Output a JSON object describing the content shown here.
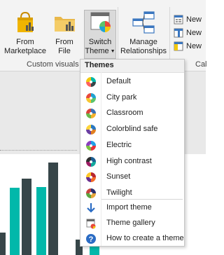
{
  "ribbon": {
    "buttons": [
      {
        "label_line1": "From",
        "label_line2": "Marketplace",
        "icon": "shopping-bag-icon"
      },
      {
        "label_line1": "From",
        "label_line2": "File",
        "icon": "folder-chart-icon"
      },
      {
        "label_line1": "Switch",
        "label_line2": "Theme",
        "icon": "switch-theme-icon"
      },
      {
        "label_line1": "Manage",
        "label_line2": "Relationships",
        "icon": "relationships-icon"
      }
    ],
    "groups": {
      "custom_visuals": "Custom visuals",
      "cal": "Cal"
    },
    "small_buttons": [
      {
        "label": "New",
        "icon": "new-measure-icon"
      },
      {
        "label": "New",
        "icon": "new-column-icon"
      },
      {
        "label": "New",
        "icon": "new-table-icon"
      }
    ]
  },
  "menu": {
    "header": "Themes",
    "themes": [
      {
        "label": "Default",
        "colors": [
          "#01b8aa",
          "#374649",
          "#fd625e",
          "#f2c80f"
        ]
      },
      {
        "label": "City park",
        "colors": [
          "#20a3d3",
          "#5ac46c",
          "#f7c631",
          "#e8493b"
        ]
      },
      {
        "label": "Classroom",
        "colors": [
          "#3a6fb5",
          "#f5b12b",
          "#69b84a",
          "#d9453a"
        ]
      },
      {
        "label": "Colorblind safe",
        "colors": [
          "#2a78c2",
          "#e07f22",
          "#6b3fa0",
          "#ffd43b"
        ]
      },
      {
        "label": "Electric",
        "colors": [
          "#1ea0e8",
          "#e6333a",
          "#7cc242",
          "#8a3fbf"
        ]
      },
      {
        "label": "High contrast",
        "colors": [
          "#1d5f91",
          "#13a89e",
          "#9b1d64",
          "#2f2f2f"
        ]
      },
      {
        "label": "Sunset",
        "colors": [
          "#b8272f",
          "#f46a27",
          "#6a2f8f",
          "#ffc627"
        ]
      },
      {
        "label": "Twilight",
        "colors": [
          "#2b2f6d",
          "#e6a53a",
          "#5aa53f",
          "#c6453e"
        ]
      }
    ],
    "actions": [
      {
        "label": "Import theme",
        "icon": "import-arrow-icon"
      },
      {
        "label": "Theme gallery",
        "icon": "theme-gallery-icon"
      },
      {
        "label": "How to create a theme",
        "icon": "help-icon"
      }
    ]
  },
  "colors": {
    "teal": "#01b8aa",
    "dark": "#374649"
  }
}
